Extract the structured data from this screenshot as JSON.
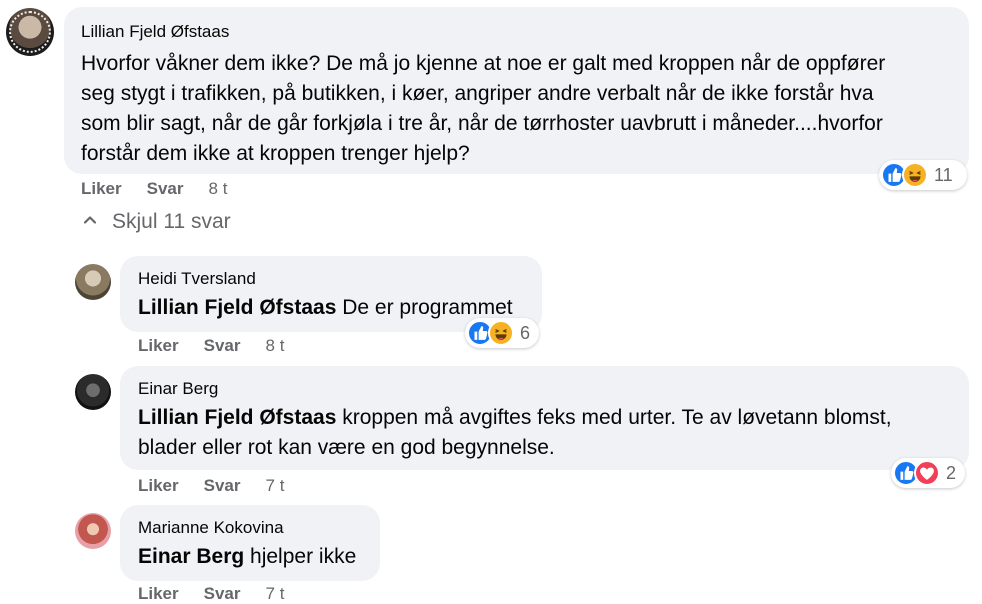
{
  "icons": {
    "like": "like-icon",
    "haha": "haha-icon",
    "love": "love-icon",
    "collapse": "chevron-up-icon"
  },
  "colors": {
    "like_blue": "#1877f2",
    "haha_yellow": "#f7b125",
    "love_red": "#f33e58",
    "bubble_bg": "#f0f2f5",
    "meta_text": "#65676b"
  },
  "comments": [
    {
      "author": "Lillian Fjeld Øfstaas",
      "text_lines": [
        "Hvorfor våkner dem ikke? De må jo kjenne at noe er galt med kroppen når de oppfører",
        "seg stygt i trafikken, på butikken, i køer, angriper andre verbalt når de ikke forstår hva",
        "som blir sagt, når de går forkjøla i tre år, når de tørrhoster uavbrutt i måneder....hvorfor",
        "forstår dem ikke at kroppen trenger hjelp?"
      ],
      "like_label": "Liker",
      "reply_label": "Svar",
      "time": "8 t",
      "reaction_count": "11"
    }
  ],
  "hide_replies_label": "Skjul 11 svar",
  "replies": [
    {
      "author": "Heidi Tversland",
      "tag": "Lillian Fjeld Øfstaas",
      "text": " De er programmet",
      "like_label": "Liker",
      "reply_label": "Svar",
      "time": "8 t",
      "reaction_count": "6"
    },
    {
      "author": "Einar Berg",
      "tag": "Lillian Fjeld Øfstaas",
      "text": " kroppen må avgiftes feks med urter. Te av løvetann blomst,",
      "text_line2": "blader eller rot kan være en god begynnelse.",
      "like_label": "Liker",
      "reply_label": "Svar",
      "time": "7 t",
      "reaction_count": "2"
    },
    {
      "author": "Marianne Kokovina",
      "tag": "Einar Berg",
      "text": " hjelper ikke",
      "like_label": "Liker",
      "reply_label": "Svar",
      "time": "7 t"
    }
  ]
}
